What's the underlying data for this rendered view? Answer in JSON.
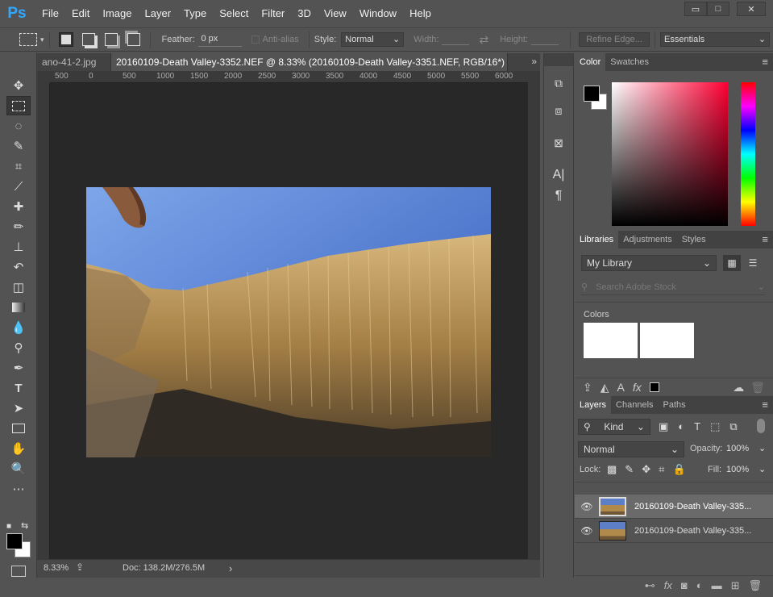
{
  "app": {
    "logo": "Ps"
  },
  "menu": [
    "File",
    "Edit",
    "Image",
    "Layer",
    "Type",
    "Select",
    "Filter",
    "3D",
    "View",
    "Window",
    "Help"
  ],
  "window_controls": [
    "▭",
    "□",
    "✕"
  ],
  "options": {
    "feather_label": "Feather:",
    "feather_value": "0 px",
    "antialias_label": "Anti-alias",
    "style_label": "Style:",
    "style_value": "Normal",
    "width_label": "Width:",
    "height_label": "Height:",
    "refine_edge": "Refine Edge...",
    "workspace": "Essentials"
  },
  "doc_tabs": [
    {
      "label": "ano-41-2.jpg",
      "close": "×"
    },
    {
      "label": "20160109-Death Valley-3352.NEF @ 8.33% (20160109-Death Valley-3351.NEF, RGB/16*) *",
      "close": "×"
    }
  ],
  "tabs_overflow": "»",
  "ruler_numbers": [
    "500",
    "0",
    "500",
    "1000",
    "1500",
    "2000",
    "2500",
    "3000",
    "3500",
    "4000",
    "4500",
    "5000",
    "5500",
    "6000"
  ],
  "status": {
    "zoom": "8.33%",
    "doc": "Doc: 138.2M/276.5M",
    "arrow": "›"
  },
  "color_panel": {
    "tabs": [
      "Color",
      "Swatches"
    ],
    "foreground": "#000000",
    "background": "#ffffff"
  },
  "libraries_panel": {
    "tabs": [
      "Libraries",
      "Adjustments",
      "Styles"
    ],
    "library": "My Library",
    "search_placeholder": "Search Adobe Stock",
    "colors_label": "Colors"
  },
  "layers_panel": {
    "tabs": [
      "Layers",
      "Channels",
      "Paths"
    ],
    "kind": "Kind",
    "blend_mode": "Normal",
    "opacity_label": "Opacity:",
    "opacity_value": "100%",
    "lock_label": "Lock:",
    "fill_label": "Fill:",
    "fill_value": "100%",
    "layers": [
      {
        "name": "20160109-Death Valley-335...",
        "selected": true
      },
      {
        "name": "20160109-Death Valley-335...",
        "selected": false
      }
    ]
  },
  "panel_menu": "≡"
}
